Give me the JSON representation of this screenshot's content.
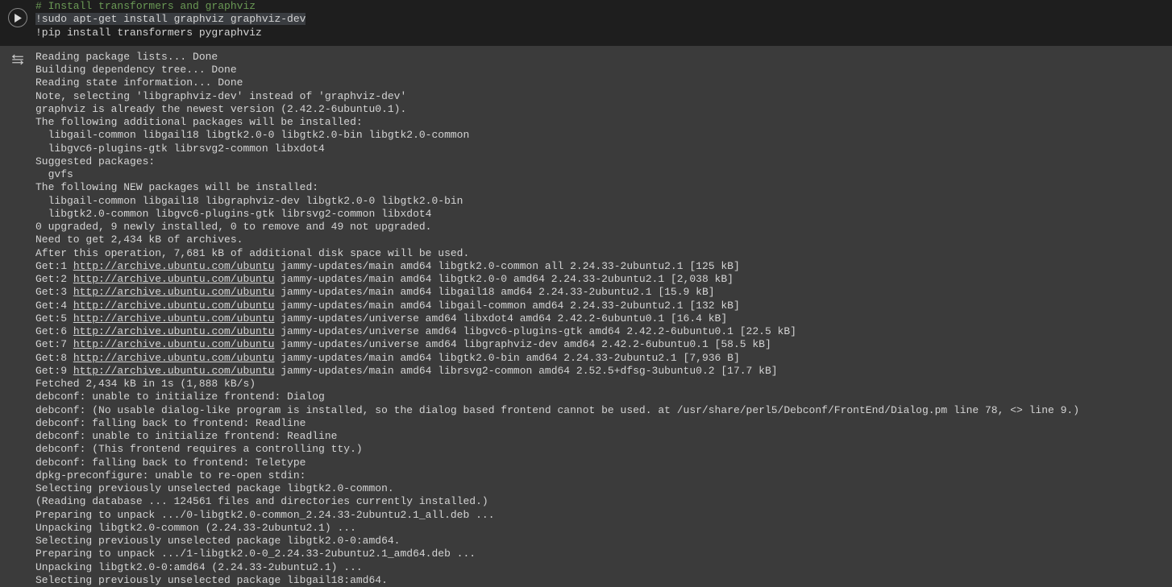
{
  "code": {
    "comment": "# Install transformers and graphviz",
    "line2": "!sudo apt-get install graphviz graphviz-dev",
    "line3": "!pip install transformers pygraphviz"
  },
  "output": {
    "pre_lines": [
      "Reading package lists... Done",
      "Building dependency tree... Done",
      "Reading state information... Done",
      "Note, selecting 'libgraphviz-dev' instead of 'graphviz-dev'",
      "graphviz is already the newest version (2.42.2-6ubuntu0.1).",
      "The following additional packages will be installed:",
      "  libgail-common libgail18 libgtk2.0-0 libgtk2.0-bin libgtk2.0-common",
      "  libgvc6-plugins-gtk librsvg2-common libxdot4",
      "Suggested packages:",
      "  gvfs",
      "The following NEW packages will be installed:",
      "  libgail-common libgail18 libgraphviz-dev libgtk2.0-0 libgtk2.0-bin",
      "  libgtk2.0-common libgvc6-plugins-gtk librsvg2-common libxdot4",
      "0 upgraded, 9 newly installed, 0 to remove and 49 not upgraded.",
      "Need to get 2,434 kB of archives.",
      "After this operation, 7,681 kB of additional disk space will be used."
    ],
    "gets": [
      {
        "prefix": "Get:1 ",
        "url": "http://archive.ubuntu.com/ubuntu",
        "suffix": " jammy-updates/main amd64 libgtk2.0-common all 2.24.33-2ubuntu2.1 [125 kB]"
      },
      {
        "prefix": "Get:2 ",
        "url": "http://archive.ubuntu.com/ubuntu",
        "suffix": " jammy-updates/main amd64 libgtk2.0-0 amd64 2.24.33-2ubuntu2.1 [2,038 kB]"
      },
      {
        "prefix": "Get:3 ",
        "url": "http://archive.ubuntu.com/ubuntu",
        "suffix": " jammy-updates/main amd64 libgail18 amd64 2.24.33-2ubuntu2.1 [15.9 kB]"
      },
      {
        "prefix": "Get:4 ",
        "url": "http://archive.ubuntu.com/ubuntu",
        "suffix": " jammy-updates/main amd64 libgail-common amd64 2.24.33-2ubuntu2.1 [132 kB]"
      },
      {
        "prefix": "Get:5 ",
        "url": "http://archive.ubuntu.com/ubuntu",
        "suffix": " jammy-updates/universe amd64 libxdot4 amd64 2.42.2-6ubuntu0.1 [16.4 kB]"
      },
      {
        "prefix": "Get:6 ",
        "url": "http://archive.ubuntu.com/ubuntu",
        "suffix": " jammy-updates/universe amd64 libgvc6-plugins-gtk amd64 2.42.2-6ubuntu0.1 [22.5 kB]"
      },
      {
        "prefix": "Get:7 ",
        "url": "http://archive.ubuntu.com/ubuntu",
        "suffix": " jammy-updates/universe amd64 libgraphviz-dev amd64 2.42.2-6ubuntu0.1 [58.5 kB]"
      },
      {
        "prefix": "Get:8 ",
        "url": "http://archive.ubuntu.com/ubuntu",
        "suffix": " jammy-updates/main amd64 libgtk2.0-bin amd64 2.24.33-2ubuntu2.1 [7,936 B]"
      },
      {
        "prefix": "Get:9 ",
        "url": "http://archive.ubuntu.com/ubuntu",
        "suffix": " jammy-updates/main amd64 librsvg2-common amd64 2.52.5+dfsg-3ubuntu0.2 [17.7 kB]"
      }
    ],
    "post_lines": [
      "Fetched 2,434 kB in 1s (1,888 kB/s)",
      "debconf: unable to initialize frontend: Dialog",
      "debconf: (No usable dialog-like program is installed, so the dialog based frontend cannot be used. at /usr/share/perl5/Debconf/FrontEnd/Dialog.pm line 78, <> line 9.)",
      "debconf: falling back to frontend: Readline",
      "debconf: unable to initialize frontend: Readline",
      "debconf: (This frontend requires a controlling tty.)",
      "debconf: falling back to frontend: Teletype",
      "dpkg-preconfigure: unable to re-open stdin:",
      "Selecting previously unselected package libgtk2.0-common.",
      "(Reading database ... 124561 files and directories currently installed.)",
      "Preparing to unpack .../0-libgtk2.0-common_2.24.33-2ubuntu2.1_all.deb ...",
      "Unpacking libgtk2.0-common (2.24.33-2ubuntu2.1) ...",
      "Selecting previously unselected package libgtk2.0-0:amd64.",
      "Preparing to unpack .../1-libgtk2.0-0_2.24.33-2ubuntu2.1_amd64.deb ...",
      "Unpacking libgtk2.0-0:amd64 (2.24.33-2ubuntu2.1) ...",
      "Selecting previously unselected package libgail18:amd64."
    ]
  }
}
